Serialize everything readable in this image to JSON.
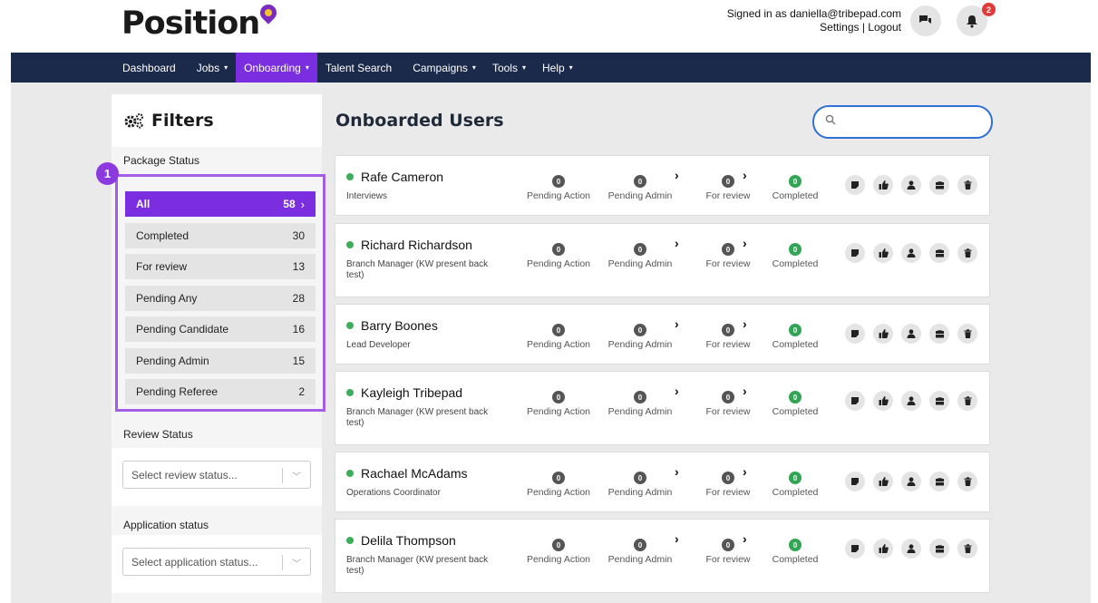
{
  "brand": {
    "name": "Position"
  },
  "account": {
    "signed_in": "Signed in as daniella@tribepad.com",
    "settings": "Settings",
    "separator": " | ",
    "logout": "Logout",
    "notifications_count": "2"
  },
  "nav": [
    {
      "label": "Dashboard",
      "caret": ""
    },
    {
      "label": "Jobs",
      "caret": "▾"
    },
    {
      "label": "Onboarding",
      "caret": "▾",
      "active": true
    },
    {
      "label": "Talent Search",
      "caret": ""
    },
    {
      "label": "Campaigns",
      "caret": "▾"
    },
    {
      "label": "Tools",
      "caret": "▾"
    },
    {
      "label": "Help",
      "caret": "▾"
    }
  ],
  "sidebar": {
    "title": "Filters",
    "package_status_label": "Package Status",
    "callout_number": "1",
    "filters": [
      {
        "label": "All",
        "count": "58"
      },
      {
        "label": "Completed",
        "count": "30"
      },
      {
        "label": "For review",
        "count": "13"
      },
      {
        "label": "Pending Any",
        "count": "28"
      },
      {
        "label": "Pending Candidate",
        "count": "16"
      },
      {
        "label": "Pending Admin",
        "count": "15"
      },
      {
        "label": "Pending Referee",
        "count": "2"
      }
    ],
    "review_status_label": "Review Status",
    "review_placeholder": "Select review status...",
    "application_status_label": "Application status",
    "application_placeholder": "Select application status..."
  },
  "main": {
    "title": "Onboarded Users",
    "stage_labels": [
      "Pending Action",
      "Pending Admin",
      "For review",
      "Completed"
    ],
    "users": [
      {
        "name": "Rafe Cameron",
        "role": "Interviews",
        "counts": [
          "0",
          "0",
          "0",
          "0"
        ]
      },
      {
        "name": "Richard Richardson",
        "role": "Branch Manager (KW present back test)",
        "counts": [
          "0",
          "0",
          "0",
          "0"
        ]
      },
      {
        "name": "Barry Boones",
        "role": "Lead Developer",
        "counts": [
          "0",
          "0",
          "0",
          "0"
        ]
      },
      {
        "name": "Kayleigh Tribepad",
        "role": "Branch Manager (KW present back test)",
        "counts": [
          "0",
          "0",
          "0",
          "0"
        ]
      },
      {
        "name": "Rachael McAdams",
        "role": "Operations Coordinator",
        "counts": [
          "0",
          "0",
          "0",
          "0"
        ]
      },
      {
        "name": "Delila Thompson",
        "role": "Branch Manager (KW present back test)",
        "counts": [
          "0",
          "0",
          "0",
          "0"
        ]
      }
    ],
    "action_icons": [
      "note-icon",
      "thumbs-up-icon",
      "user-icon",
      "briefcase-icon",
      "trash-icon"
    ]
  },
  "colors": {
    "nav_bg": "#1b2a4a",
    "accent": "#7b2ee0",
    "highlight_border": "#a35ee8",
    "status_green": "#31a553",
    "search_border": "#2f6fd6"
  }
}
